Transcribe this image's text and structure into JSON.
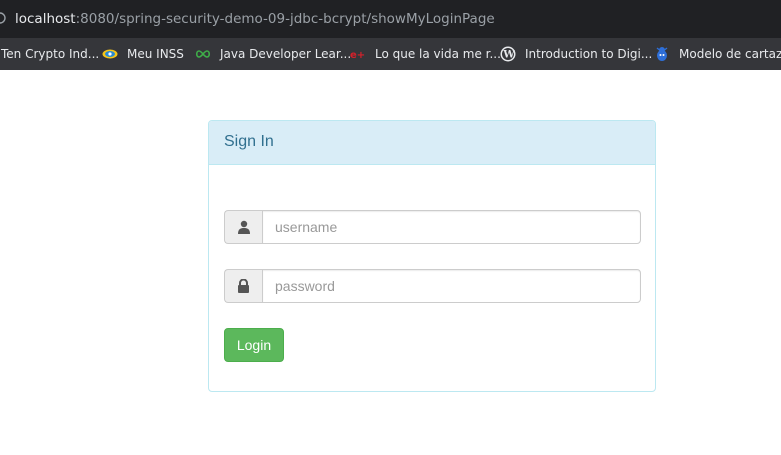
{
  "browser": {
    "url_host": "localhost",
    "url_path": ":8080/spring-security-demo-09-jdbc-bcrypt/showMyLoginPage"
  },
  "bookmarks": [
    {
      "label": "Ten Crypto Ind...",
      "icon": "none"
    },
    {
      "label": "Meu INSS",
      "icon": "inss-icon"
    },
    {
      "label": "Java Developer Lear...",
      "icon": "infinity-icon"
    },
    {
      "label": "Lo que la vida me r...",
      "icon": "red-logo-icon"
    },
    {
      "label": "Introduction to Digi...",
      "icon": "wordpress-icon"
    },
    {
      "label": "Modelo de cartaz d",
      "icon": "blue-bug-icon"
    }
  ],
  "login": {
    "heading": "Sign In",
    "username_placeholder": "username",
    "password_placeholder": "password",
    "submit_label": "Login"
  },
  "colors": {
    "panel_heading_bg": "#d9edf7",
    "panel_border": "#bce8f1",
    "heading_text": "#31708f",
    "login_button": "#5cb85c"
  }
}
